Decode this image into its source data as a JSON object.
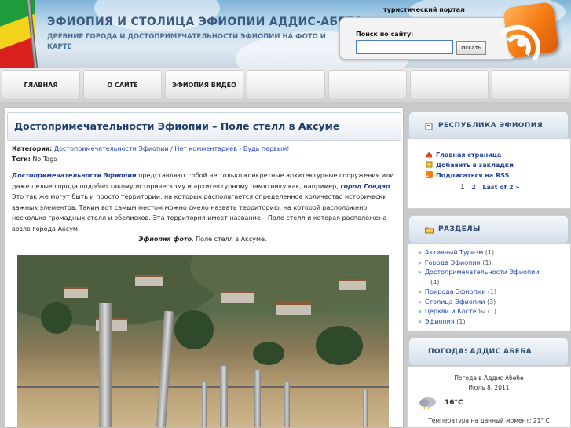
{
  "header": {
    "site_title": "ЭФИОПИЯ И СТОЛИЦА ЭФИОПИИ АДДИС-АБЕБА",
    "site_subtitle": "ДРЕВНИЕ ГОРОДА И ДОСТОПРИМЕЧАТЕЛЬНОСТИ ЭФИОПИИ НА ФОТО И КАРТЕ",
    "portal_label": "туристический портал",
    "search_label": "Поиск по сайту:",
    "search_value": "",
    "search_button": "Искать"
  },
  "nav": {
    "items": [
      {
        "label": "ГЛАВНАЯ"
      },
      {
        "label": "О САЙТЕ"
      },
      {
        "label": "ЭФИОПИЯ ВИДЕО"
      },
      {
        "label": ""
      },
      {
        "label": ""
      },
      {
        "label": ""
      },
      {
        "label": ""
      }
    ]
  },
  "post": {
    "title": "Достопримечательности Эфиопии – Поле стелл в Аксуме",
    "category_label": "Категория:",
    "category_link": "Достопримечательности Эфиопии",
    "comments_link": " / Нет комментариев - Будь первым!",
    "tags_label": "Теги:",
    "tags_value": "No Tags",
    "lead_link": "Достопримечательности Эфиопии",
    "body_1": " представляют собой не только конкретные архитектурные сооружения или даже целые города подобно такому историческому и архитектурному памятнику как, например, ",
    "city_link": "город Гондэр",
    "body_2": ". Это так же могут быть и просто территории, на которых располагается определенное количество исторически важных элементов. Таким вот самым местом можно смело назвать территорию, на которой расположено несколько громадных стелл и обелисков. Эта территория имеет название – Поле стелл и которая расположена возле города Аксум.",
    "caption_em": "Эфиопия фото",
    "caption_rest": ". Поле стелл в Аксуме."
  },
  "sidebar": {
    "republic": {
      "title": "РЕСПУБЛИКА ЭФИОПИЯ",
      "links": [
        {
          "label": "Главная страница",
          "icon": "home-icon"
        },
        {
          "label": "Добавить в закладки",
          "icon": "bookmark-icon"
        },
        {
          "label": "Подписаться на RSS",
          "icon": "rss-icon"
        }
      ],
      "pager": {
        "page1": "1",
        "page2": "2",
        "last": "Last of 2 »"
      }
    },
    "sections": {
      "title": "РАЗДЕЛЫ",
      "items": [
        {
          "label": "Активный Туризм",
          "count": "(1)"
        },
        {
          "label": "Города Эфиопии",
          "count": "(1)"
        },
        {
          "label": "Достопримечательности Эфиопии",
          "count": ""
        },
        {
          "label": "",
          "count": "(4)"
        },
        {
          "label": "Природа Эфиопии",
          "count": "(1)"
        },
        {
          "label": "Столица Эфиопии",
          "count": "(3)"
        },
        {
          "label": "Церкви и Костелы",
          "count": "(1)"
        },
        {
          "label": "Эфиопия",
          "count": "(1)"
        }
      ]
    },
    "weather": {
      "title": "ПОГОДА: АДДИС АБЕБА",
      "line1": "Погода в Аддис Абебе",
      "line2": "Июль 8, 2011",
      "temp": "16°C",
      "footer": "Температура на данный момент: 21° C"
    }
  },
  "colors": {
    "link": "#2247a8",
    "title": "#1f3d6b",
    "rss": "#f57d14"
  }
}
